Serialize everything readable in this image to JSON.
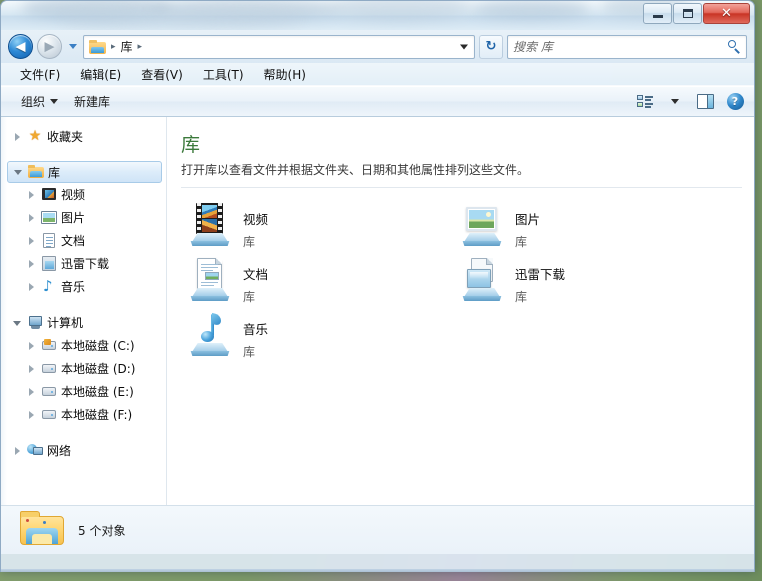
{
  "window": {
    "controls": {
      "minimize_label": "–",
      "maximize_label": "□",
      "close_label": "✕"
    }
  },
  "nav": {
    "back_glyph": "◀",
    "forward_glyph": "▶",
    "refresh_glyph": "↻",
    "breadcrumb": [
      {
        "label": "库",
        "sep": "▸"
      }
    ],
    "breadcrumb_leading_sep": "▸"
  },
  "search": {
    "placeholder": "搜索 库",
    "value": ""
  },
  "menubar": {
    "items": [
      {
        "label": "文件(F)"
      },
      {
        "label": "编辑(E)"
      },
      {
        "label": "查看(V)"
      },
      {
        "label": "工具(T)"
      },
      {
        "label": "帮助(H)"
      }
    ]
  },
  "commandbar": {
    "organize_label": "组织",
    "new_library_label": "新建库",
    "help_glyph": "?"
  },
  "sidebar": {
    "groups": [
      {
        "label": "收藏夹",
        "icon": "star-icon",
        "expanded": false,
        "children": []
      },
      {
        "label": "库",
        "icon": "library-icon",
        "expanded": true,
        "selected": true,
        "children": [
          {
            "label": "视频",
            "icon": "film-icon"
          },
          {
            "label": "图片",
            "icon": "picture-icon"
          },
          {
            "label": "文档",
            "icon": "document-icon"
          },
          {
            "label": "迅雷下载",
            "icon": "download-icon"
          },
          {
            "label": "音乐",
            "icon": "music-icon"
          }
        ]
      },
      {
        "label": "计算机",
        "icon": "computer-icon",
        "expanded": true,
        "children": [
          {
            "label": "本地磁盘 (C:)",
            "icon": "system-drive-icon"
          },
          {
            "label": "本地磁盘 (D:)",
            "icon": "drive-icon"
          },
          {
            "label": "本地磁盘 (E:)",
            "icon": "drive-icon"
          },
          {
            "label": "本地磁盘 (F:)",
            "icon": "drive-icon"
          }
        ]
      },
      {
        "label": "网络",
        "icon": "network-icon",
        "expanded": false,
        "children": []
      }
    ]
  },
  "content": {
    "title": "库",
    "description": "打开库以查看文件并根据文件夹、日期和其他属性排列这些文件。",
    "items": [
      {
        "name": "视频",
        "subtitle": "库",
        "icon": "video-library-icon"
      },
      {
        "name": "图片",
        "subtitle": "库",
        "icon": "pictures-library-icon"
      },
      {
        "name": "文档",
        "subtitle": "库",
        "icon": "documents-library-icon"
      },
      {
        "name": "迅雷下载",
        "subtitle": "库",
        "icon": "downloads-library-icon"
      },
      {
        "name": "音乐",
        "subtitle": "库",
        "icon": "music-library-icon"
      }
    ]
  },
  "statusbar": {
    "text": "5 个对象"
  }
}
